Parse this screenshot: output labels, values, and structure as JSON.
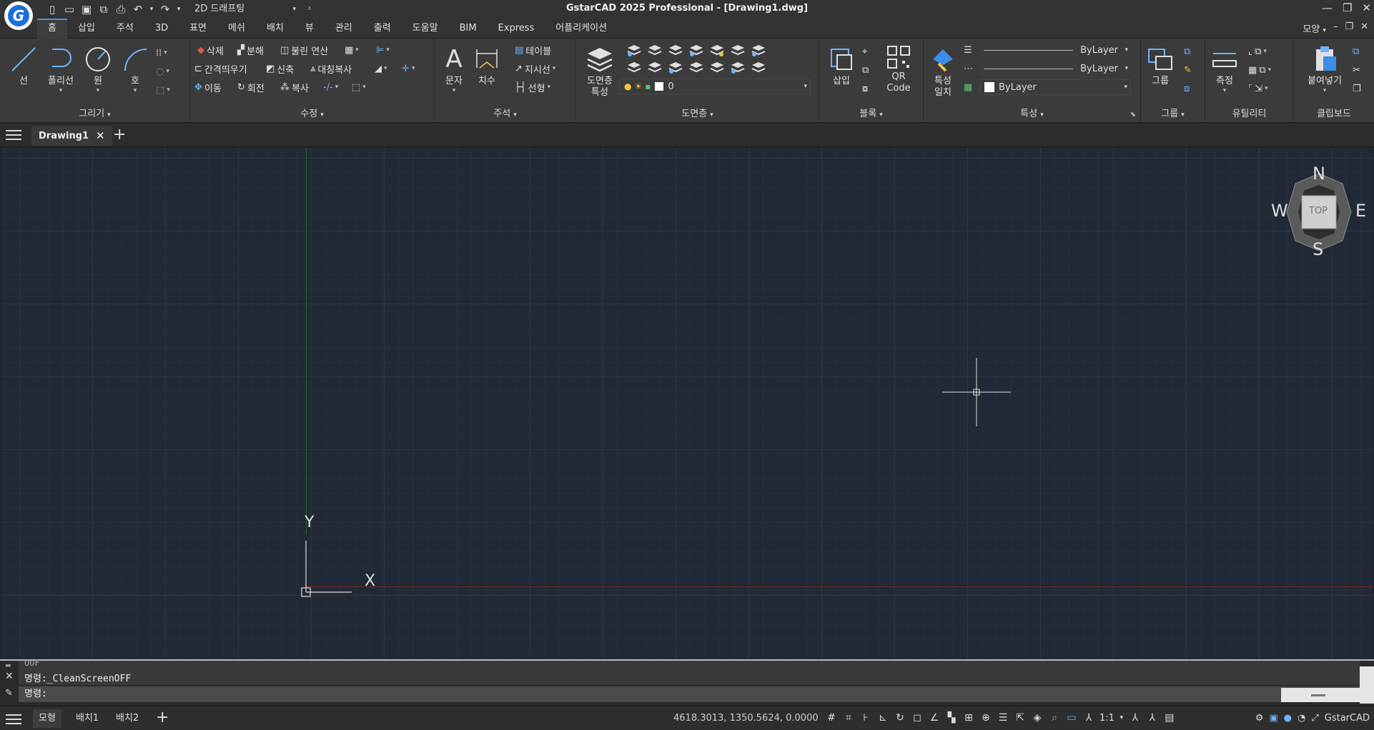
{
  "app": {
    "title": "GstarCAD 2025 Professional - [Drawing1.dwg]",
    "workspace": "2D 드래프팅"
  },
  "menubar": {
    "tabs": [
      "홈",
      "삽입",
      "주석",
      "3D",
      "표면",
      "메쉬",
      "배치",
      "뷰",
      "관리",
      "출력",
      "도움말",
      "BIM",
      "Express",
      "어플리케이션"
    ],
    "active_tab": "홈",
    "style_label": "모양"
  },
  "ribbon": {
    "draw": {
      "title": "그리기",
      "buttons": [
        "선",
        "폴리선",
        "원",
        "호"
      ]
    },
    "modify": {
      "title": "수정",
      "row1": [
        "삭제",
        "분해",
        "불린 연산"
      ],
      "row2": [
        "간격띄우기",
        "신축",
        "대칭복사"
      ],
      "row3": [
        "이동",
        "회전",
        "복사"
      ]
    },
    "annotation": {
      "title": "주석",
      "buttons": [
        "문자",
        "치수"
      ],
      "row1": "테이블",
      "row2": "지시선",
      "row3": "선형"
    },
    "layers": {
      "title": "도면층",
      "button_line1": "도면층",
      "button_line2": "특성",
      "current_layer": "0"
    },
    "block": {
      "title": "블록",
      "insert": "삽입",
      "qr_line1": "QR",
      "qr_line2": "Code"
    },
    "properties": {
      "title": "특성",
      "match_line1": "특성",
      "match_line2": "일치",
      "color": "ByLayer",
      "linetype": "ByLayer",
      "lineweight": "ByLayer"
    },
    "group": {
      "title": "그룹",
      "button": "그룹"
    },
    "utilities": {
      "title": "유틸리티",
      "measure": "측정"
    },
    "clipboard": {
      "title": "클립보드",
      "paste": "붙여넣기"
    }
  },
  "document": {
    "tab_name": "Drawing1"
  },
  "viewcube": {
    "top": "TOP",
    "n": "N",
    "s": "S",
    "e": "E",
    "w": "W"
  },
  "ucs": {
    "x_label": "X",
    "y_label": "Y"
  },
  "command": {
    "history_prev": "OOF",
    "history_line": "명령:_CleanScreenOFF",
    "prompt": "명령:"
  },
  "status": {
    "layouts": [
      "모형",
      "배치1",
      "배치2"
    ],
    "active_layout": "모형",
    "coordinates": "4618.3013, 1350.5624, 0.0000",
    "scale": "1:1",
    "brand": "GstarCAD"
  },
  "colors": {
    "canvas_bg": "#212936",
    "ribbon_bg": "#3b3b3b",
    "accent": "#4a90e2"
  }
}
